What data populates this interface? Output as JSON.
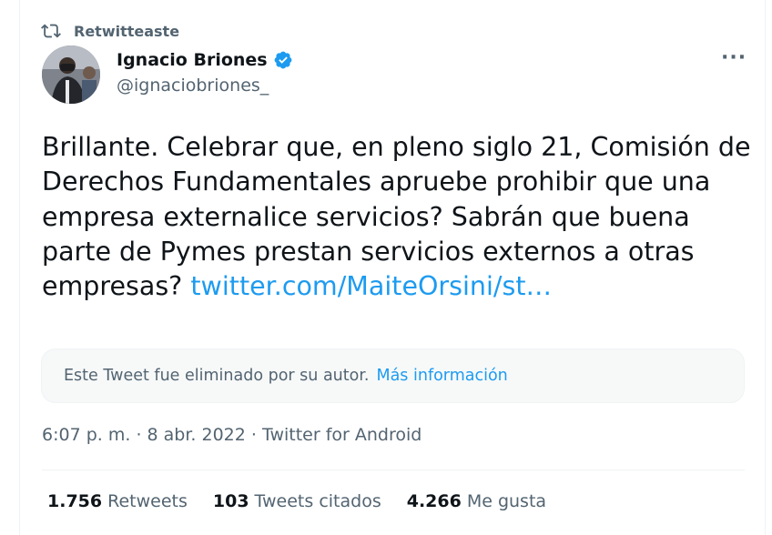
{
  "retweet": {
    "label": "Retwitteaste",
    "icon": "retweet-icon"
  },
  "author": {
    "name": "Ignacio Briones",
    "handle": "@ignaciobriones_",
    "verified_icon": "verified-badge-icon",
    "avatar_icon": "avatar"
  },
  "menu": {
    "glyph": "···",
    "icon": "more-icon"
  },
  "tweet": {
    "text": "Brillante. Celebrar que, en pleno siglo 21, Comisión de Derechos Fundamentales apruebe prohibir que una empresa externalice servicios? Sabrán que buena parte de Pymes prestan servicios externos a otras empresas? ",
    "link": "twitter.com/MaiteOrsini/st…"
  },
  "quoted": {
    "deleted_text": "Este Tweet fue eliminado por su autor.",
    "more_info": "Más información"
  },
  "meta": {
    "time": "6:07 p. m.",
    "separator": " · ",
    "date": "8 abr. 2022",
    "source": "Twitter for Android"
  },
  "stats": {
    "retweets_value": "1.756",
    "retweets_label": "Retweets",
    "quotes_value": "103",
    "quotes_label": "Tweets citados",
    "likes_value": "4.266",
    "likes_label": "Me gusta"
  },
  "colors": {
    "accent": "#1d9bf0",
    "text": "#0f1419",
    "muted": "#536471",
    "border": "#eff3f4",
    "box_bg": "#f7f9f9"
  }
}
